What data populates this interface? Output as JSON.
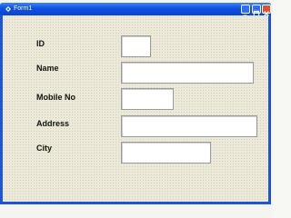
{
  "window": {
    "title": "Form1"
  },
  "form": {
    "fields": [
      {
        "label": "ID",
        "value": ""
      },
      {
        "label": "Name",
        "value": ""
      },
      {
        "label": "Mobile No",
        "value": ""
      },
      {
        "label": "Address",
        "value": ""
      },
      {
        "label": "City",
        "value": ""
      }
    ]
  },
  "icons": {
    "app": "form-icon",
    "minimize": "minimize-icon",
    "maximize": "maximize-icon",
    "close": "close-icon"
  },
  "colors": {
    "titlebar": "#0f4fe0",
    "close_button": "#e1502a",
    "client_background": "#ece9d8"
  }
}
